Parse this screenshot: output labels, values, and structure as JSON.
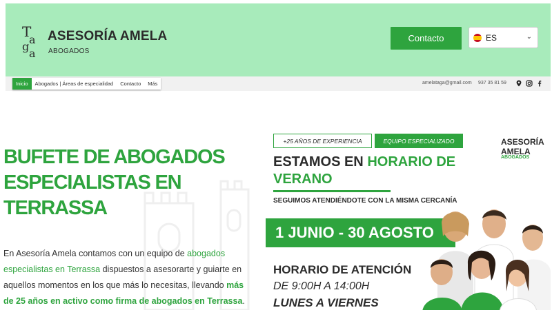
{
  "header": {
    "logo_alt": "Taga logo",
    "brand_name": "ASESORÍA AMELA",
    "brand_sub": "ABOGADOS",
    "contact_button": "Contacto",
    "language": "ES"
  },
  "nav": {
    "items": [
      {
        "label": "Inicio"
      },
      {
        "label": "Abogados | Áreas de especialidad"
      },
      {
        "label": "Contacto"
      },
      {
        "label": "Más"
      }
    ],
    "email": "amelataga@gmail.com",
    "phone": "937 35 81 59"
  },
  "hero": {
    "title": "BUFETE DE ABOGADOS ESPECIALISTAS EN TERRASSA",
    "para_1": "En Asesoría Amela contamos con un equipo de ",
    "para_link_1": "abogados especialistas en Terrassa",
    "para_2": " dispuestos a asesorarte y guiarte en aquellos momentos en los que más lo necesitas, llevando ",
    "para_link_2": "más de 25 años en activo como firma de abogados en Terrassa",
    "para_3": "."
  },
  "promo": {
    "pill_experience": "+25 AÑOS DE EXPERIENCIA",
    "pill_team": "EQUIPO ESPECIALIZADO",
    "brand_line_1": "ASESORÍA",
    "brand_line_2": "AMELA",
    "brand_line_3": "ABOGADOS",
    "title_plain": "ESTAMOS EN ",
    "title_highlight": "HORARIO DE VERANO",
    "subtitle": "SEGUIMOS ATENDIÉNDOTE CON LA MISMA CERCANÍA",
    "dates": "1 JUNIO - 30 AGOSTO",
    "hours_title": "HORARIO DE ATENCIÓN",
    "hours_range": "DE 9:00H A 14:00H",
    "days": "LUNES A VIERNES"
  },
  "colors": {
    "header_bg": "#a8ebbb",
    "accent": "#2ea43e",
    "text": "#2b2b2b"
  },
  "icons": [
    "map-pin-icon",
    "instagram-icon",
    "facebook-icon",
    "chevron-down-icon",
    "spain-flag-icon"
  ]
}
